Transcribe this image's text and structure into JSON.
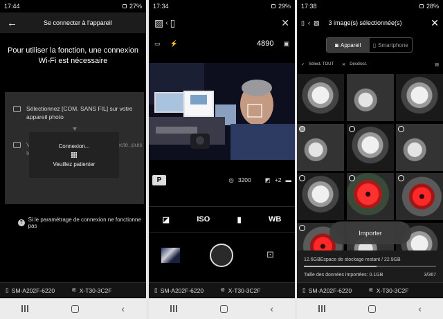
{
  "screen1": {
    "status": {
      "time": "17:44",
      "battery": "27%"
    },
    "title": "Se connecter à l'appareil",
    "requirement_text": "Pour utiliser la fonction, une connexion Wi-Fi est nécessaire",
    "step1": "Sélectionnez [COM. SANS FIL] sur votre appareil photo",
    "step2": "Vérifiez si l'appareil photo est connecté, puis touchez « ... »",
    "modal": {
      "line1": "Connexion...",
      "line2": "Veuillez patienter"
    },
    "help_text": "Si le paramétrage de connexion ne fonctionne pas",
    "device_phone": "SM-A202F-6220",
    "device_camera": "X-T30-3C2F"
  },
  "screen2": {
    "status": {
      "time": "17:34",
      "battery": "29%"
    },
    "shots_remaining": "4890",
    "iso_value": "3200",
    "exposure_comp": "+2",
    "mode": "P",
    "tools": {
      "iso": "ISO",
      "wb": "WB"
    },
    "device_phone": "SM-A202F-6220",
    "device_camera": "X-T30-3C2F"
  },
  "screen3": {
    "status": {
      "time": "17:38",
      "battery": "28%"
    },
    "title": "3 image(s) sélectionnée(s)",
    "tab_camera": "Appareil",
    "tab_phone": "Smartphone",
    "select_all": "Sélect. TOUT",
    "deselect": "Désélect.",
    "import_label": "Importer",
    "storage_text": "12.6GBEspace de stockage restant / 22.9GB",
    "storage_used_fraction": 0.55,
    "imported_size_text": "Taille des données importées: 0.1GB",
    "count": "3/367",
    "device_phone": "SM-A202F-6220",
    "device_camera": "X-T30-3C2F"
  }
}
